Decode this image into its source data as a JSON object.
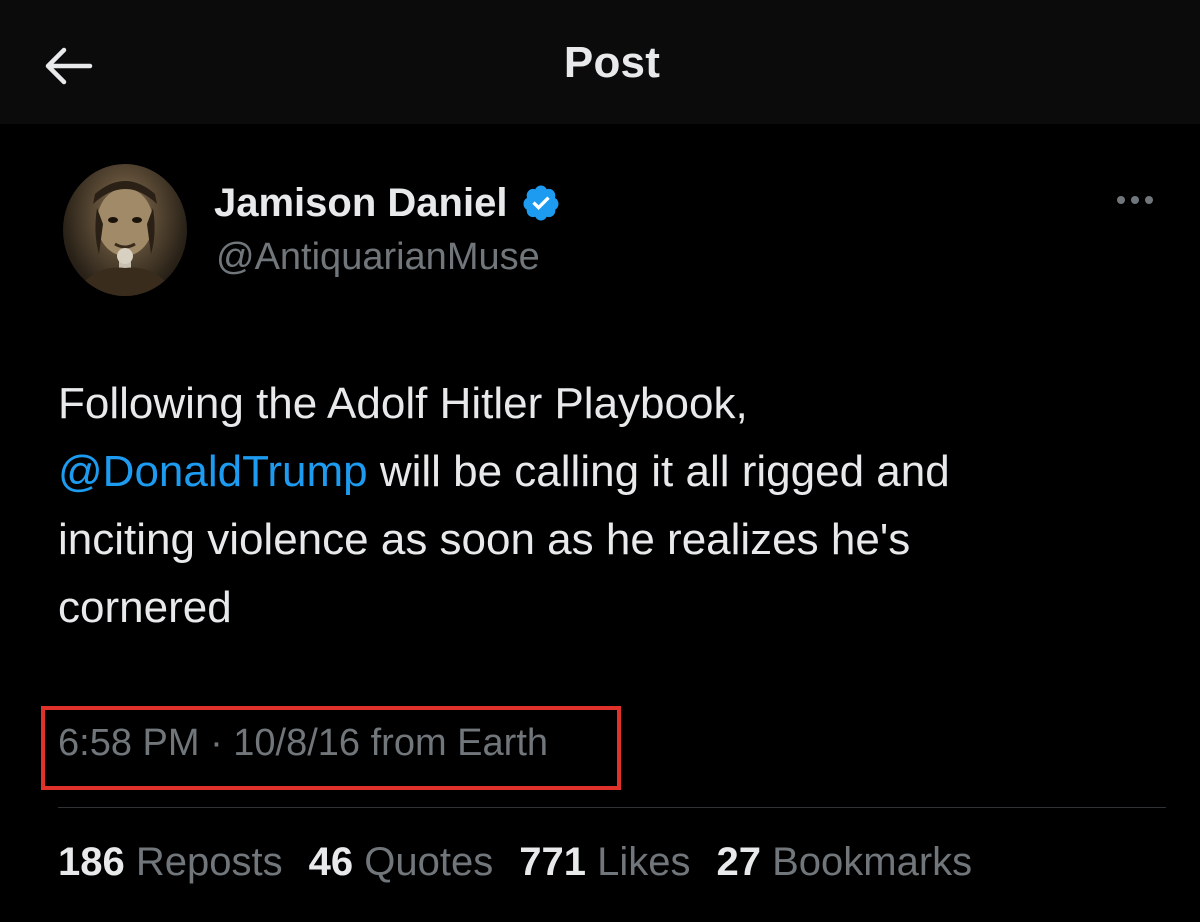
{
  "header": {
    "title": "Post",
    "back_icon": "arrow-left-icon"
  },
  "post": {
    "author": {
      "display_name": "Jamison Daniel",
      "handle": "@AntiquarianMuse",
      "verified_icon": "verified-badge-icon"
    },
    "more_icon": "more-options-icon",
    "text": {
      "line1": "Following the Adolf Hitler Playbook,",
      "mention": "@DonaldTrump",
      "after_mention": " will be calling it all rigged and",
      "line3": "inciting violence as soon as he realizes he's",
      "line4": "cornered"
    },
    "meta": "6:58 PM · 10/8/16 from Earth",
    "stats": {
      "reposts": {
        "count": "186",
        "label": "Reposts"
      },
      "quotes": {
        "count": "46",
        "label": "Quotes"
      },
      "likes": {
        "count": "771",
        "label": "Likes"
      },
      "bookmarks": {
        "count": "27",
        "label": "Bookmarks"
      }
    }
  },
  "colors": {
    "background": "#000000",
    "header_background": "#0b0b0b",
    "primary_text": "#e7e9ea",
    "secondary_text": "#71767b",
    "link": "#1d9bf0",
    "highlight_box": "#e0312b"
  }
}
